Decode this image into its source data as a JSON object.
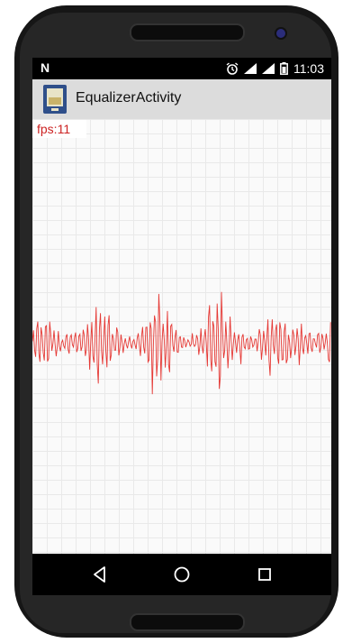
{
  "status_bar": {
    "notification_icon": "n-logo-icon",
    "alarm_icon": "alarm-icon",
    "signal_icon": "signal-icon",
    "battery_icon": "battery-icon",
    "time": "11:03"
  },
  "app_bar": {
    "icon": "app-icon",
    "title": "EqualizerActivity"
  },
  "content": {
    "fps": "fps:11",
    "waveform_color": "#e53935",
    "grid_color": "#e9e9e9"
  },
  "nav_bar": {
    "back_icon": "back-triangle-icon",
    "home_icon": "home-circle-icon",
    "recents_icon": "recents-square-icon"
  }
}
